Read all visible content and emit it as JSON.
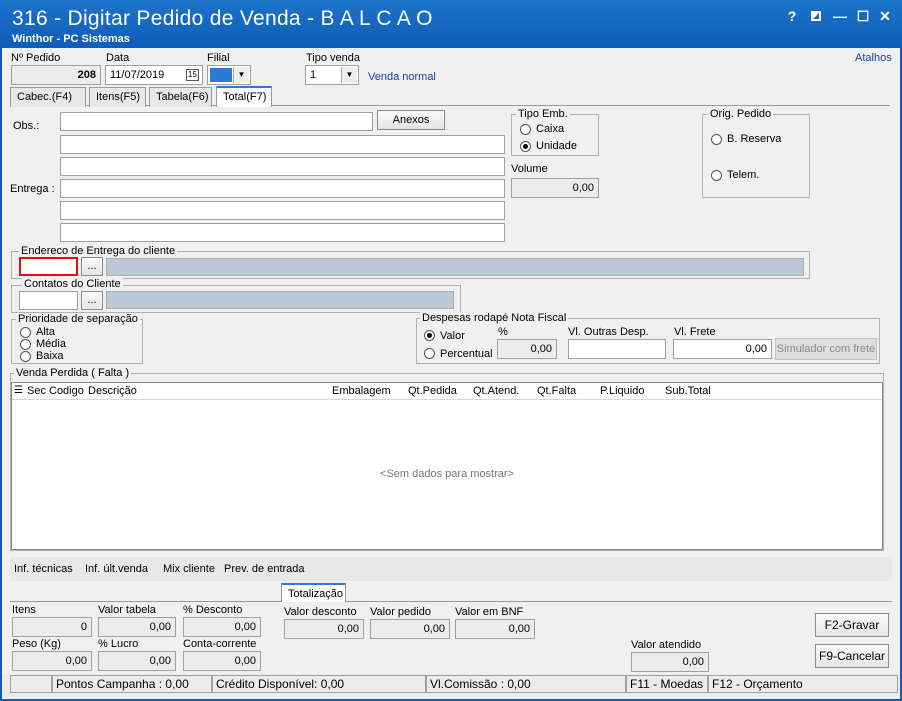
{
  "window": {
    "title": "316 - Digitar Pedido de Venda - B A L C A O",
    "subtitle": "Winthor - PC Sistemas",
    "help": "?",
    "minimize": "—",
    "maximize": "☐",
    "close": "✕"
  },
  "header": {
    "pedido_label": "Nº Pedido",
    "pedido_value": "208",
    "data_label": "Data",
    "data_value": "11/07/2019",
    "calendar_icon": "15",
    "filial_label": "Filial",
    "tipo_venda_label": "Tipo venda",
    "tipo_venda_value": "1",
    "tipo_venda_desc": "Venda normal",
    "atalhos": "Atalhos"
  },
  "tabs": [
    {
      "label": "Cabec.(F4)"
    },
    {
      "label": "Itens(F5)"
    },
    {
      "label": "Tabela(F6)"
    },
    {
      "label": "Total(F7)"
    }
  ],
  "obs": {
    "label": "Obs.:",
    "anexos": "Anexos",
    "entrega_label": "Entrega :"
  },
  "tipo_emb": {
    "label": "Tipo Emb.",
    "caixa": "Caixa",
    "unidade": "Unidade",
    "volume_label": "Volume",
    "volume_value": "0,00"
  },
  "orig_pedido": {
    "label": "Orig. Pedido",
    "reserva": "B. Reserva",
    "telem": "Telem."
  },
  "endereco": {
    "label": "Endereco de Entrega do cliente",
    "btn": "..."
  },
  "contatos": {
    "label": "Contatos do Cliente",
    "btn": "..."
  },
  "prioridade": {
    "label": "Prioridade de separação",
    "alta": "Alta",
    "media": "Média",
    "baixa": "Baixa"
  },
  "despesas": {
    "label": "Despesas rodapé Nota Fiscal",
    "valor": "Valor",
    "percentual": "Percentual",
    "pct_label": "%",
    "pct_value": "0,00",
    "outras_label": "Vl. Outras Desp.",
    "frete_label": "Vl. Frete",
    "frete_value": "0,00",
    "simulador": "Simulador com frete"
  },
  "venda_perdida": {
    "label": "Venda Perdida ( Falta )",
    "columns": [
      "Sec",
      "Codigo",
      "Descrição",
      "Embalagem",
      "Qt.Pedida",
      "Qt.Atend.",
      "Qt.Falta",
      "P.Liquido",
      "Sub.Total"
    ],
    "empty": "<Sem dados para mostrar>"
  },
  "links": [
    "Inf. técnicas",
    "Inf. últ.venda",
    "Mix cliente",
    "Prev. de entrada"
  ],
  "totalizacao": {
    "tab": "Totalização",
    "itens_label": "Itens",
    "itens_value": "0",
    "valor_tabela_label": "Valor tabela",
    "valor_tabela_value": "0,00",
    "desconto_label": "% Desconto",
    "desconto_value": "0,00",
    "valor_desconto_label": "Valor desconto",
    "valor_desconto_value": "0,00",
    "valor_pedido_label": "Valor pedido",
    "valor_pedido_value": "0,00",
    "valor_bnf_label": "Valor em BNF",
    "valor_bnf_value": "0,00",
    "peso_label": "Peso (Kg)",
    "peso_value": "0,00",
    "lucro_label": "% Lucro",
    "lucro_value": "0,00",
    "conta_label": "Conta-corrente",
    "conta_value": "0,00",
    "atendido_label": "Valor atendido",
    "atendido_value": "0,00",
    "gravar": "F2-Gravar",
    "cancelar": "F9-Cancelar"
  },
  "status": {
    "pontos": "Pontos Campanha : 0,00",
    "credito": "Crédito Disponível: 0,00",
    "comissao": "Vl.Comissão : 0,00",
    "moedas": "F11 - Moedas",
    "orcamento": "F12 - Orçamento"
  }
}
